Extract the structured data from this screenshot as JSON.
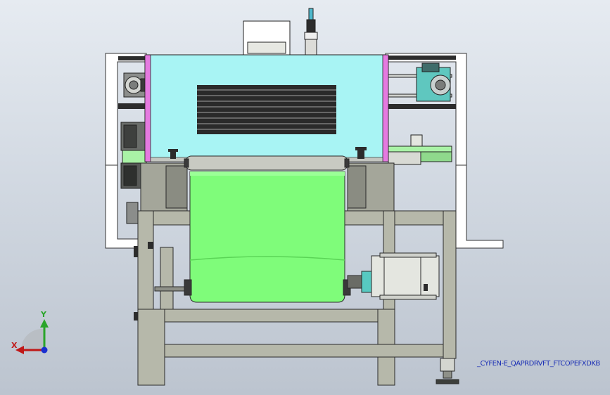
{
  "viewport": {
    "background_top": "#e6ebf1",
    "background_bottom": "#bcc4cf",
    "config_name": "_CYFEN-E_QAPRDRVFT_FTCOPEFXDKB"
  },
  "triad": {
    "y_label": "Y",
    "x_label": "X",
    "y_color": "#2aa52a",
    "x_color": "#c01818",
    "z_color": "#1a2fd0"
  },
  "colors": {
    "frame": "#b6b8aa",
    "hood": "#a8f4f4",
    "belt": "#7ffc7a",
    "accent_pink": "#e57ae0",
    "motor": "#e4e6e0",
    "motor_cap": "#57c9c1",
    "panel": "#ffffff"
  }
}
